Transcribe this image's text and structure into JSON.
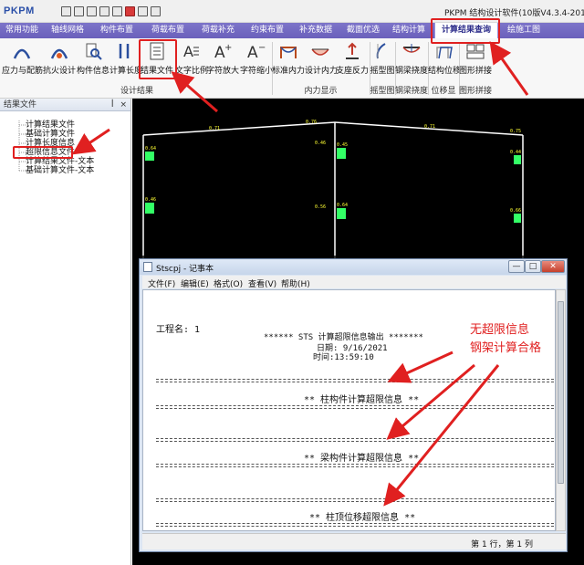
{
  "app": {
    "logo": "PKPM",
    "title": "PKPM 结构设计软件(10版V4.3.4-2019"
  },
  "tabs": [
    "常用功能",
    "轴线网格",
    "构件布置",
    "荷载布置",
    "荷载补充",
    "约束布置",
    "补充数据",
    "截面优选",
    "结构计算",
    "计算结果查询",
    "绘施工图"
  ],
  "active_tab": "计算结果查询",
  "ribbon": {
    "buttons": [
      "应力与配筋",
      "抗火设计",
      "构件信息",
      "计算长度",
      "结果文件",
      "文字比例",
      "字符放大",
      "字符缩小",
      "标准内力",
      "设计内力",
      "支座反力",
      "摇型图",
      "钢梁挠度",
      "结构位移",
      "图形拼接"
    ],
    "groups": [
      "设计结果",
      "内力显示",
      "摇型图",
      "钢梁挠度",
      "位移显示",
      "图形拼接"
    ]
  },
  "panel": {
    "title": "结果文件",
    "pin": "ꟾ",
    "close": "×",
    "items": [
      "计算结果文件",
      "基础计算文件",
      "计算长度信息",
      "超限信息文件",
      "计算结果文件-文本",
      "基础计算文件-文本"
    ]
  },
  "canvas": {
    "frame_labels": [
      "0.71",
      "0.76",
      "0.71",
      "0.75",
      "0.64",
      "0.46",
      "0.45",
      "0.64",
      "0.46",
      "0.56",
      "0.44",
      "0.66"
    ]
  },
  "notepad": {
    "title": "Stscpj - 记事本",
    "buttons": {
      "minimize": "—",
      "maximize": "□",
      "close": "✕"
    },
    "menu": [
      "文件(F)",
      "编辑(E)",
      "格式(O)",
      "查看(V)",
      "帮助(H)"
    ],
    "content": {
      "project": "工程名: 1",
      "header": "****** STS 计算超限信息输出 *******",
      "date": "日期: 9/16/2021",
      "time": "时间:13:59:10",
      "column": "** 柱构件计算超限信息 **",
      "beam": "** 梁构件计算超限信息 **",
      "disp": "** 柱顶位移超限信息 **"
    },
    "status": "第 1 行，第 1 列"
  },
  "annotation": {
    "line1": "无超限信息",
    "line2": "钢架计算合格",
    "color": "#e02020"
  }
}
